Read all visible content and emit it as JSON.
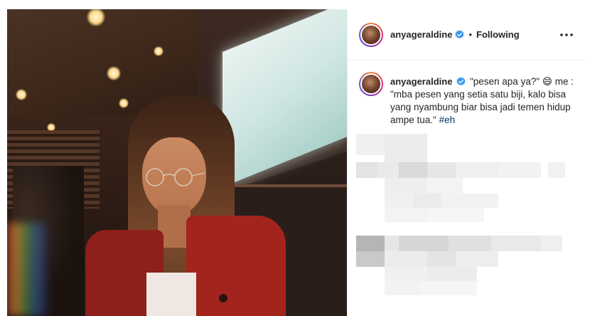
{
  "post": {
    "username": "anyageraldine",
    "separator": "•",
    "follow_status": "Following",
    "caption_parts": [
      "\"pesen apa ya?\" 😄 me : \"mba pesen yang setia satu biji, kalo bisa yang nyambung biar bisa jadi temen hidup ampe tua.\" ",
      "#eh"
    ]
  },
  "icons": {
    "verified": "verified-badge-icon",
    "more": "more-options-icon"
  },
  "colors": {
    "verified_blue": "#3897f0",
    "hashtag_link": "#00376b",
    "border": "#efefef",
    "text": "#262626"
  }
}
